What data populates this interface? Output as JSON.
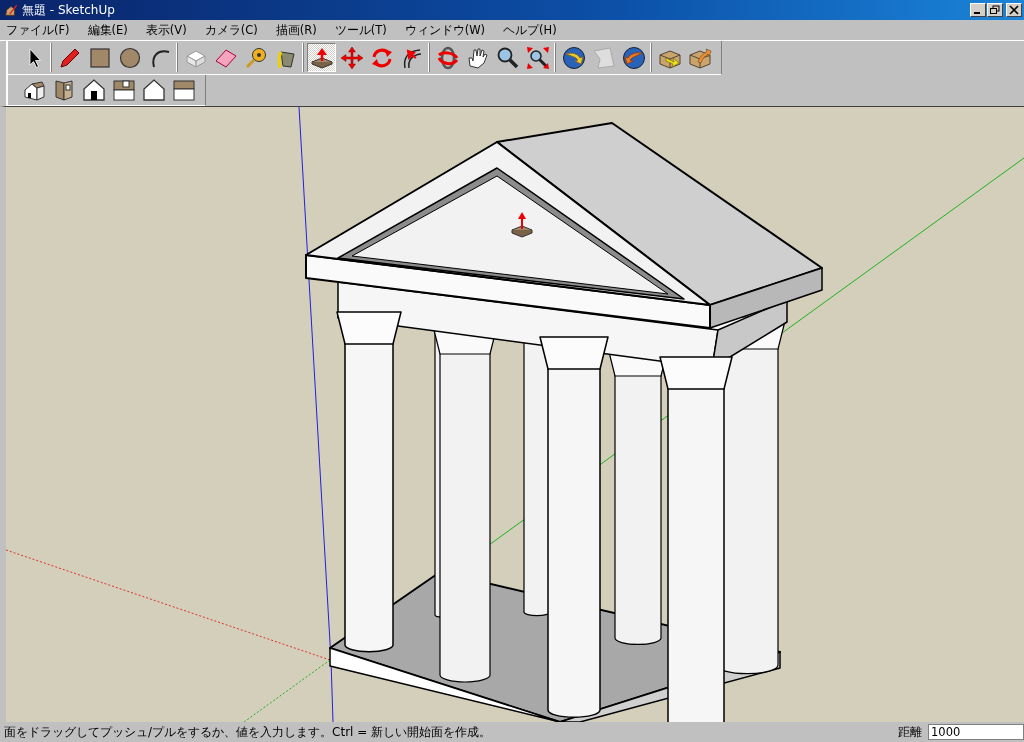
{
  "window": {
    "title": "無題 - SketchUp"
  },
  "menu": [
    "ファイル(F)",
    "編集(E)",
    "表示(V)",
    "カメラ(C)",
    "描画(R)",
    "ツール(T)",
    "ウィンドウ(W)",
    "ヘルプ(H)"
  ],
  "toolbars": [
    {
      "groups": [
        {
          "tools": [
            {
              "selected": false
            }
          ]
        },
        {
          "tools": [
            {
              "selected": false
            },
            {
              "selected": false
            },
            {
              "selected": false
            },
            {
              "selected": false
            }
          ]
        },
        {
          "tools": [
            {
              "selected": false
            },
            {
              "selected": false
            },
            {
              "selected": false
            },
            {
              "selected": false
            }
          ]
        },
        {
          "tools": [
            {
              "selected": true
            },
            {
              "selected": false
            },
            {
              "selected": false
            },
            {
              "selected": false
            }
          ]
        },
        {
          "tools": [
            {
              "selected": false
            },
            {
              "selected": false
            },
            {
              "selected": false
            },
            {
              "selected": false
            }
          ]
        },
        {
          "tools": [
            {
              "selected": false
            },
            {
              "selected": false
            },
            {
              "selected": false
            }
          ]
        },
        {
          "tools": [
            {
              "selected": false
            },
            {
              "selected": false
            }
          ]
        }
      ]
    },
    {
      "groups": [
        {
          "tools": [
            {
              "selected": false
            },
            {
              "selected": false
            },
            {
              "selected": false
            },
            {
              "selected": false
            },
            {
              "selected": false
            },
            {
              "selected": false
            }
          ]
        }
      ]
    }
  ],
  "status_bar": {
    "hint": "面をドラッグしてプッシュ/プルをするか、値を入力します。Ctrl = 新しい開始面を作成。",
    "measure_label": "距離",
    "measure_value": "1000"
  }
}
